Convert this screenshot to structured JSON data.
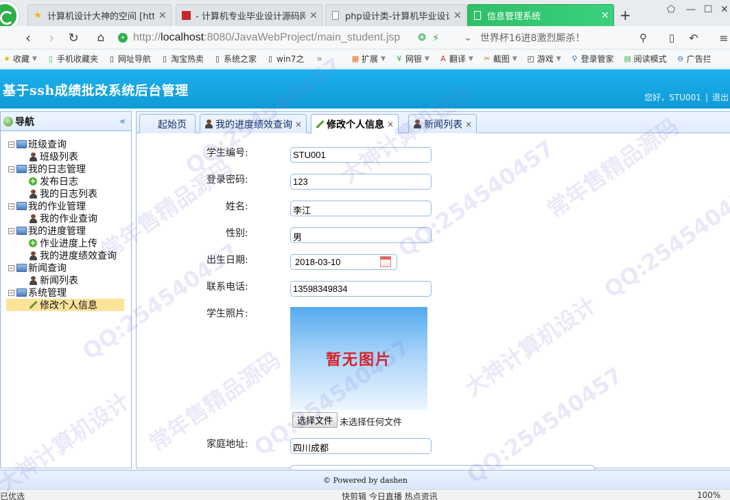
{
  "browser": {
    "tabs": [
      {
        "label": "计算机设计大神的空间 [http:",
        "icon": "star-icon"
      },
      {
        "label": "- 计算机专业毕业设计源码网",
        "icon": "flag-icon"
      },
      {
        "label": "php设计类-计算机毕业设计",
        "icon": "page-icon"
      },
      {
        "label": "信息管理系统",
        "icon": "page-icon"
      }
    ],
    "url_prefix": "http://",
    "url_host": "localhost",
    "url_rest": ":8080/JavaWebProject/main_student.jsp",
    "search_text": "世界杯16进8激烈厮杀！",
    "bookmarks": [
      "收藏",
      "手机收藏夹",
      "网址导航",
      "淘宝热卖",
      "系统之家",
      "win7之"
    ],
    "bookmarks_right": [
      "扩展",
      "网银",
      "翻译",
      "截图",
      "游戏",
      "登录管家",
      "阅读模式",
      "广告拦"
    ]
  },
  "app": {
    "title": "基于ssh成绩批改系统后台管理",
    "greeting": "您好，STU001",
    "logout": "退出"
  },
  "nav": {
    "title": "导航",
    "collapse": "«",
    "groups": [
      {
        "label": "班级查询",
        "items": [
          "班级列表"
        ]
      },
      {
        "label": "我的日志管理",
        "items": [
          "发布日志",
          "我的日志列表"
        ]
      },
      {
        "label": "我的作业管理",
        "items": [
          "我的作业查询"
        ]
      },
      {
        "label": "我的进度管理",
        "items": [
          "作业进度上传",
          "我的进度绩效查询"
        ]
      },
      {
        "label": "新闻查询",
        "items": [
          "新闻列表"
        ]
      },
      {
        "label": "系统管理",
        "items": [
          "修改个人信息"
        ]
      }
    ]
  },
  "tabs": {
    "home": "起始页",
    "progress": "我的进度绩效查询",
    "profile": "修改个人信息",
    "news": "新闻列表",
    "close": "×"
  },
  "form": {
    "student_no_label": "学生编号:",
    "student_no": "STU001",
    "password_label": "登录密码:",
    "password": "123",
    "name_label": "姓名:",
    "name": "李江",
    "gender_label": "性别:",
    "gender": "男",
    "birth_label": "出生日期:",
    "birth": "2018-03-10",
    "phone_label": "联系电话:",
    "phone": "13598349834",
    "photo_label": "学生照片:",
    "photo_placeholder": "暂无图片",
    "file_button": "选择文件",
    "file_status": "未选择任何文件",
    "address_label": "家庭地址:",
    "address": "四川成都"
  },
  "footer": "© Powered by dashen",
  "status": {
    "left": "已优选",
    "middle": "快剪辑   今日直播   热点资讯",
    "zoom": "100%"
  },
  "watermarks": [
    "QQ:254540457",
    "常年售精品源码",
    "大神计算机设计"
  ]
}
